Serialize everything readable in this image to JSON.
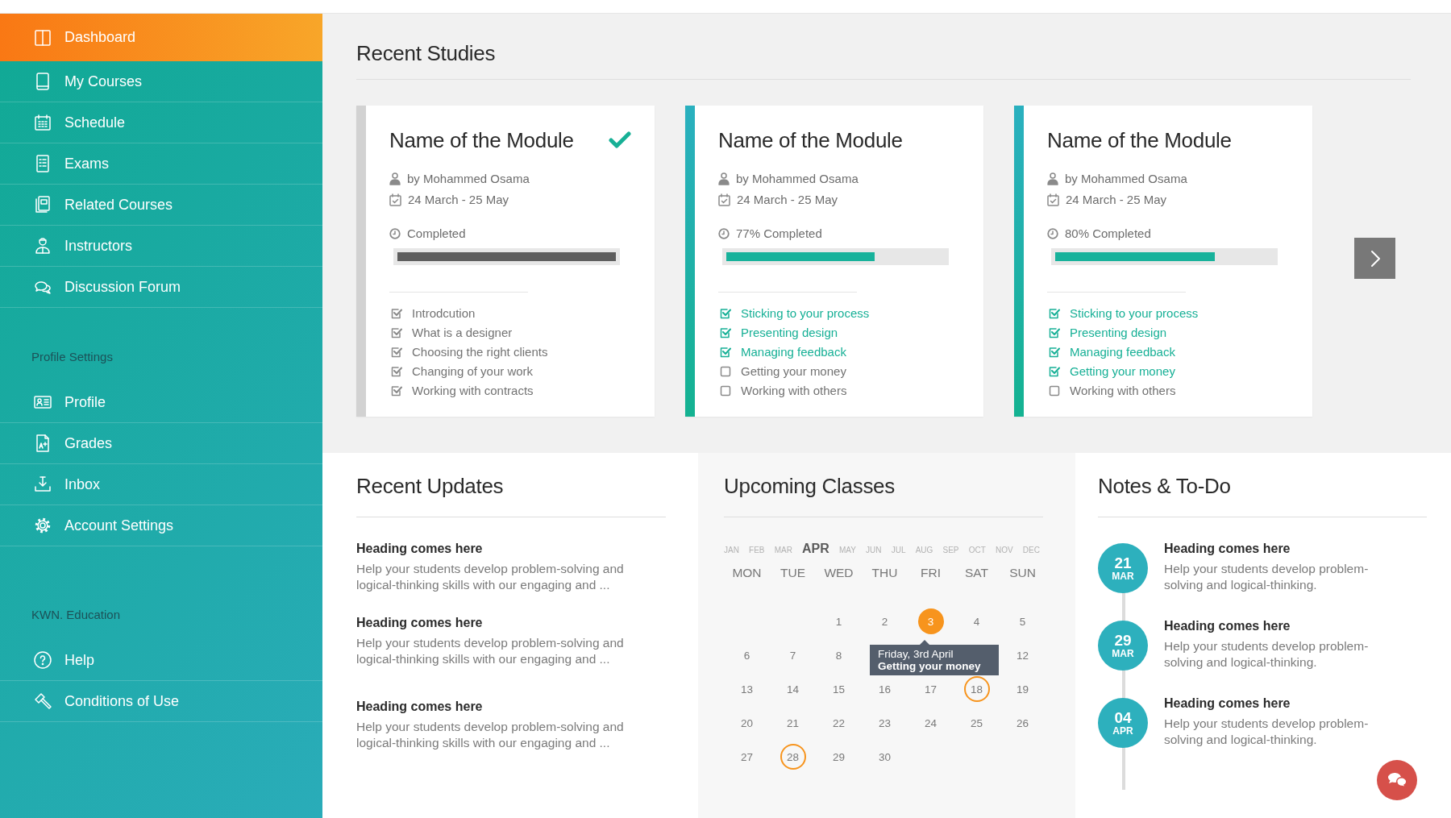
{
  "sidebar": {
    "sections": [
      {
        "items": [
          {
            "label": "Dashboard",
            "selected": true
          },
          {
            "label": "My Courses",
            "selected": false
          },
          {
            "label": "Schedule",
            "selected": false
          },
          {
            "label": "Exams",
            "selected": false
          },
          {
            "label": "Related Courses",
            "selected": false
          },
          {
            "label": "Instructors",
            "selected": false
          },
          {
            "label": "Discussion Forum",
            "selected": false
          }
        ]
      },
      {
        "heading": "Profile Settings",
        "items": [
          {
            "label": "Profile",
            "selected": false
          },
          {
            "label": "Grades",
            "selected": false
          },
          {
            "label": "Inbox",
            "selected": false
          },
          {
            "label": "Account Settings",
            "selected": false
          }
        ]
      },
      {
        "heading": "KWN. Education",
        "items": [
          {
            "label": "Help",
            "selected": false
          },
          {
            "label": "Conditions of Use",
            "selected": false
          }
        ]
      }
    ]
  },
  "recent_studies": {
    "title": "Recent Studies",
    "cards": [
      {
        "title": "Name of the Module",
        "completed": true,
        "author": "by Mohammed Osama",
        "dates": "24 March - 25 May",
        "progress_text": "Completed",
        "level": 1,
        "topics": [
          {
            "label": "Introdcution",
            "checked": true
          },
          {
            "label": "What is a designer",
            "checked": true
          },
          {
            "label": "Choosing the right clients",
            "checked": true
          },
          {
            "label": "Changing of your work",
            "checked": true
          },
          {
            "label": "Working with contracts",
            "checked": true
          }
        ]
      },
      {
        "title": "Name of the Module",
        "completed": false,
        "author": "by Mohammed Osama",
        "dates": "24 March - 25 May",
        "progress_text": "77% Completed",
        "level": 0.68,
        "topics": [
          {
            "label": "Sticking to your process",
            "checked": true
          },
          {
            "label": "Presenting design",
            "checked": true
          },
          {
            "label": "Managing feedback",
            "checked": true
          },
          {
            "label": "Getting your money",
            "checked": false
          },
          {
            "label": "Working with others",
            "checked": false
          }
        ]
      },
      {
        "title": "Name of the Module",
        "completed": false,
        "author": "by Mohammed Osama",
        "dates": "24 March - 25 May",
        "progress_text": "80% Completed",
        "level": 0.73,
        "topics": [
          {
            "label": "Sticking to your process",
            "checked": true
          },
          {
            "label": "Presenting design",
            "checked": true
          },
          {
            "label": "Managing feedback",
            "checked": true
          },
          {
            "label": "Getting your money",
            "checked": true
          },
          {
            "label": "Working with others",
            "checked": false
          }
        ]
      }
    ]
  },
  "recent_updates": {
    "title": "Recent Updates",
    "items": [
      {
        "heading": "Heading comes here",
        "text": "Help your students develop problem-solving and logical-thinking skills with our engaging and ..."
      },
      {
        "heading": "Heading comes here",
        "text": "Help your students develop problem-solving and logical-thinking skills with our engaging and ..."
      },
      {
        "heading": "Heading comes here",
        "text": "Help your students develop problem-solving and logical-thinking skills with our engaging and ..."
      }
    ]
  },
  "upcoming_classes": {
    "title": "Upcoming Classes",
    "months": [
      {
        "label": "JAN",
        "selected": false
      },
      {
        "label": "FEB",
        "selected": false
      },
      {
        "label": "MAR",
        "selected": false
      },
      {
        "label": "APR",
        "selected": true
      },
      {
        "label": "MAY",
        "selected": false
      },
      {
        "label": "JUN",
        "selected": false
      },
      {
        "label": "JUL",
        "selected": false
      },
      {
        "label": "AUG",
        "selected": false
      },
      {
        "label": "SEP",
        "selected": false
      },
      {
        "label": "OCT",
        "selected": false
      },
      {
        "label": "NOV",
        "selected": false
      },
      {
        "label": "DEC",
        "selected": false
      }
    ],
    "weekdays": [
      "MON",
      "TUE",
      "WED",
      "THU",
      "FRI",
      "SAT",
      "SUN"
    ],
    "weeks": [
      [
        {
          "kind": "blank"
        },
        {
          "kind": "blank"
        },
        {
          "day": "1",
          "kind": "plain"
        },
        {
          "day": "2",
          "kind": "plain"
        },
        {
          "day": "3",
          "kind": "filled"
        },
        {
          "day": "4",
          "kind": "plain"
        },
        {
          "day": "5",
          "kind": "plain"
        }
      ],
      [
        {
          "day": "6",
          "kind": "plain"
        },
        {
          "day": "7",
          "kind": "plain"
        },
        {
          "day": "8",
          "kind": "plain"
        },
        {
          "kind": "blank"
        },
        {
          "kind": "blank"
        },
        {
          "kind": "blank"
        },
        {
          "day": "12",
          "kind": "plain"
        }
      ],
      [
        {
          "day": "13",
          "kind": "plain"
        },
        {
          "day": "14",
          "kind": "plain"
        },
        {
          "day": "15",
          "kind": "plain"
        },
        {
          "day": "16",
          "kind": "plain"
        },
        {
          "day": "17",
          "kind": "plain"
        },
        {
          "day": "18",
          "kind": "ring"
        },
        {
          "day": "19",
          "kind": "plain"
        }
      ],
      [
        {
          "day": "20",
          "kind": "plain"
        },
        {
          "day": "21",
          "kind": "plain"
        },
        {
          "day": "22",
          "kind": "plain"
        },
        {
          "day": "23",
          "kind": "plain"
        },
        {
          "day": "24",
          "kind": "plain"
        },
        {
          "day": "25",
          "kind": "plain"
        },
        {
          "day": "26",
          "kind": "plain"
        }
      ],
      [
        {
          "day": "27",
          "kind": "plain"
        },
        {
          "day": "28",
          "kind": "ring"
        },
        {
          "day": "29",
          "kind": "plain"
        },
        {
          "day": "30",
          "kind": "plain"
        },
        {
          "kind": "blank"
        },
        {
          "kind": "blank"
        },
        {
          "kind": "blank"
        }
      ]
    ],
    "tooltip": {
      "date": "Friday, 3rd April",
      "title": "Getting your money"
    }
  },
  "notes": {
    "title": "Notes & To-Do",
    "items": [
      {
        "day": "21",
        "month": "MAR",
        "heading": "Heading comes here",
        "text": "Help your students develop problem-solving and logical-thinking."
      },
      {
        "day": "29",
        "month": "MAR",
        "heading": "Heading comes here",
        "text": "Help your students develop problem-solving and logical-thinking."
      },
      {
        "day": "04",
        "month": "APR",
        "heading": "Heading comes here",
        "text": "Help your students develop problem-solving and logical-thinking."
      }
    ]
  }
}
